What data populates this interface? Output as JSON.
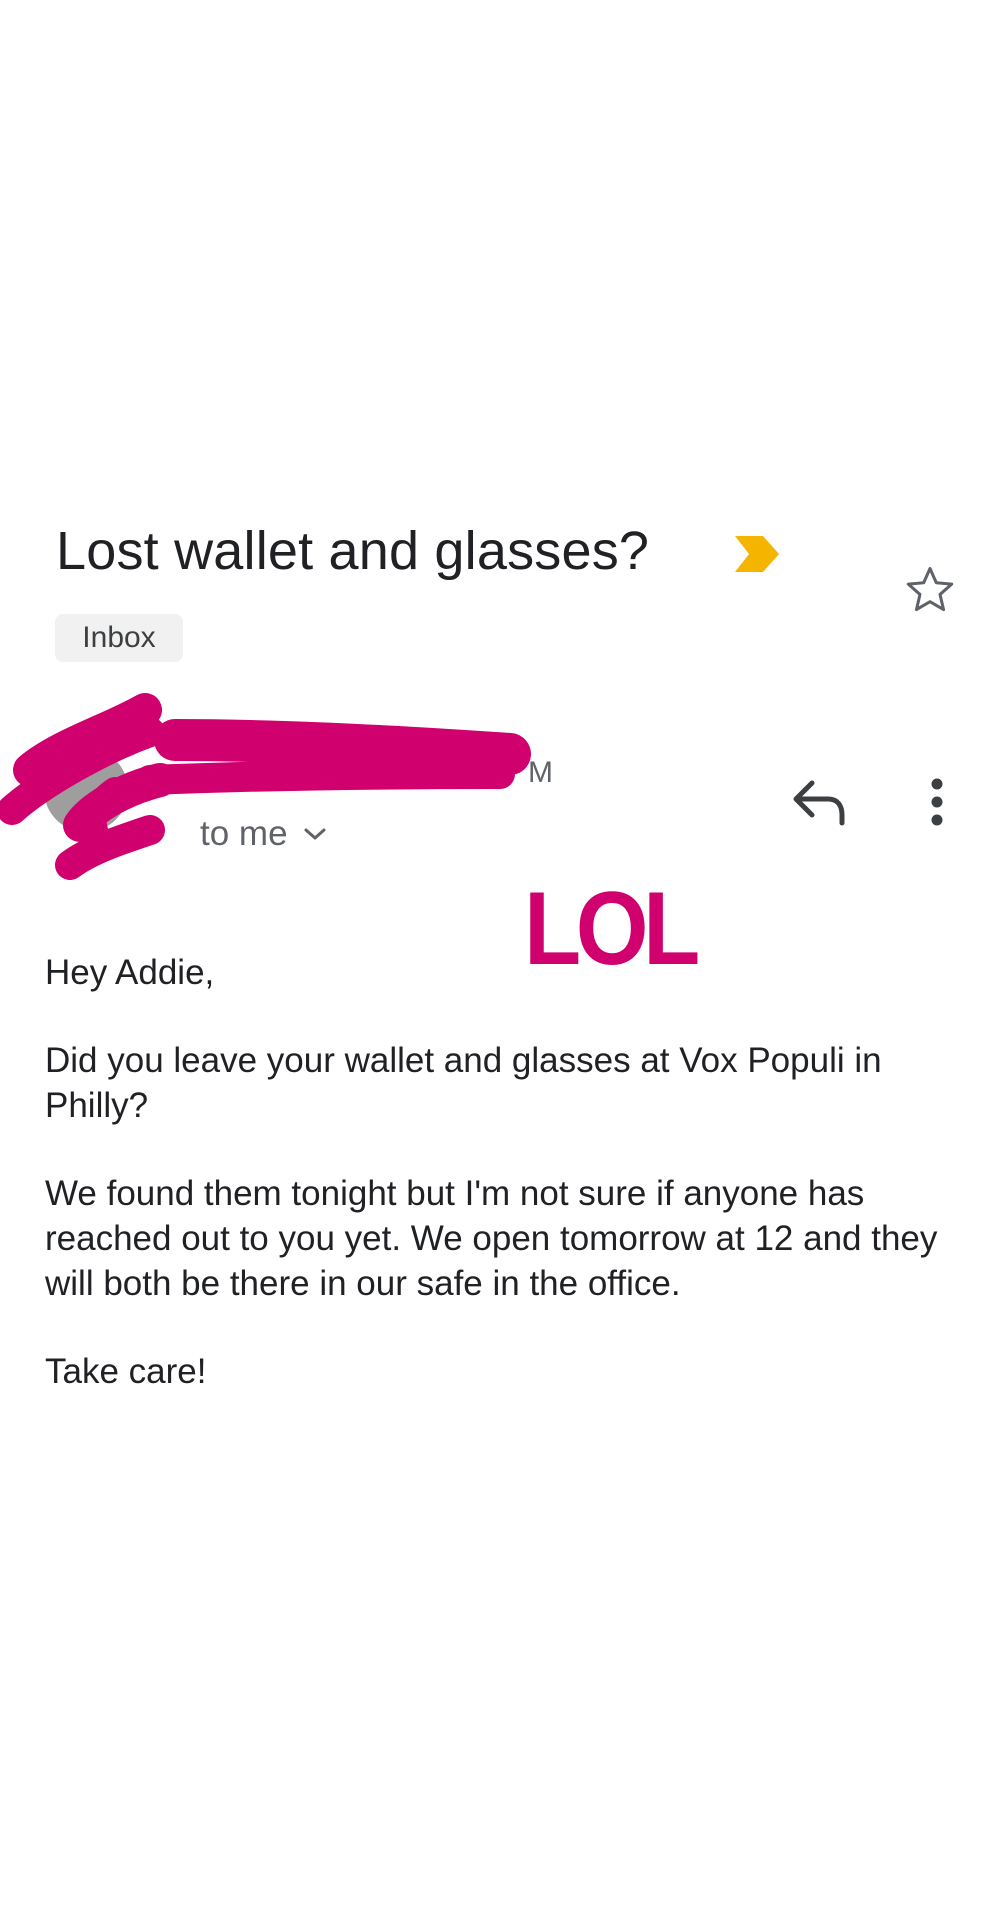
{
  "message": {
    "subject": "Lost wallet and glasses?",
    "label": "Inbox",
    "sender_time_fragment": "M",
    "recipient": "to me",
    "overlay_text": "LOL",
    "body": {
      "greeting": "Hey Addie,",
      "paragraph_1": "Did you leave your wallet and glasses at Vox Populi in Philly?",
      "paragraph_2": "We found them tonight but I'm not sure if anyone has reached out to you yet. We open tomorrow at 12 and they will both be there in our safe in the office.",
      "closing": "Take care!"
    }
  },
  "icons": {
    "importance": "importance-marker-icon",
    "star": "star-outline-icon",
    "reply": "reply-icon",
    "more": "more-vert-icon",
    "expand": "chevron-down-icon"
  },
  "colors": {
    "importance_marker": "#f4b400",
    "scribble": "#d0006f",
    "overlay_text": "#d0006f",
    "label_chip_bg": "#f1f1f1",
    "secondary_text": "#5f6368"
  }
}
